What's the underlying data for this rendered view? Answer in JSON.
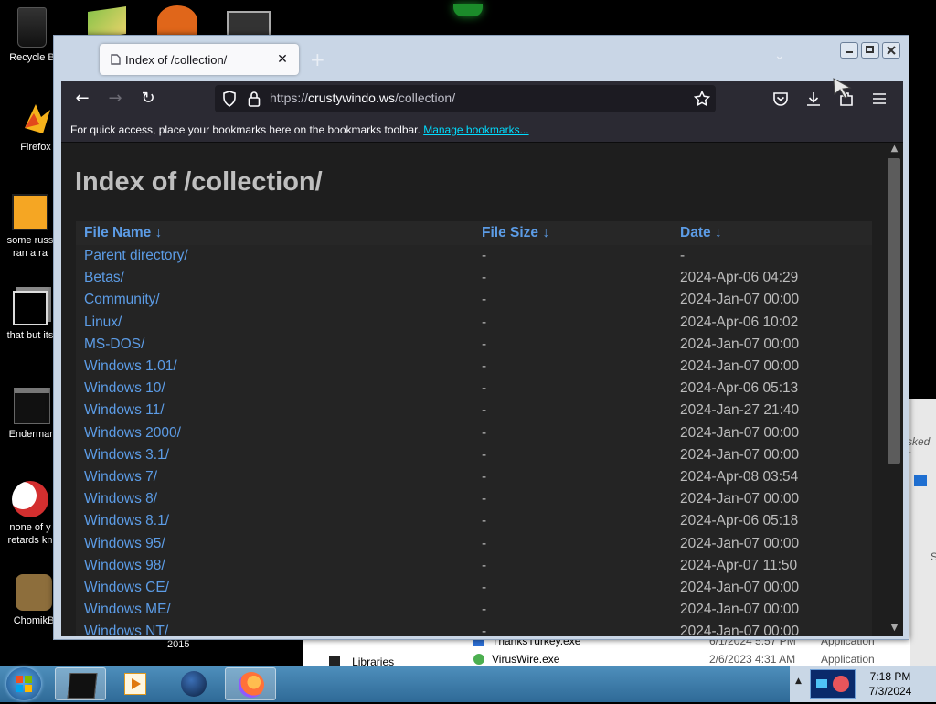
{
  "desktop": {
    "icons": [
      {
        "label": "Recycle B",
        "icon": "recycle-bin-icon"
      },
      {
        "label": "Firefox",
        "icon": "firefox-icon"
      },
      {
        "label": "some russ ran a ra",
        "icon": "program-icon"
      },
      {
        "label": "that but its",
        "icon": "shortcut-icon"
      },
      {
        "label": "Enderman",
        "icon": "terminal-icon"
      },
      {
        "label": "none of y retards kn",
        "icon": "app-icon"
      },
      {
        "label": "ChomikB",
        "icon": "chomik-icon"
      }
    ],
    "stray_label": "2015"
  },
  "explorer_back": {
    "side_item": "Libraries",
    "files": [
      {
        "name": "ThanksTurkey.exe",
        "date": "6/1/2024 5:57 PM",
        "type": "Application"
      },
      {
        "name": "VirusWire.exe",
        "date": "2/6/2023 4:31 AM",
        "type": "Application"
      }
    ],
    "peek_text": "sked r",
    "peek_letter": "S"
  },
  "browser": {
    "tab": {
      "title": "Index of /collection/",
      "close": "✕"
    },
    "new_tab": "+",
    "list_tabs": "⌄",
    "nav": {
      "back": "←",
      "forward": "→",
      "reload": "↻"
    },
    "url": {
      "prefix": "https://",
      "domain": "crustywindo.ws",
      "path": "/collection/"
    },
    "toolbar_icons": [
      "pocket-icon",
      "download-icon",
      "extensions-icon",
      "menu-icon"
    ],
    "bookmarks_bar": {
      "message": "For quick access, place your bookmarks here on the bookmarks toolbar.",
      "link": "Manage bookmarks..."
    }
  },
  "page": {
    "title": "Index of /collection/",
    "columns": [
      "File Name  ↓",
      "File Size  ↓",
      "Date  ↓"
    ],
    "rows": [
      {
        "name": "Parent directory/",
        "size": "-",
        "date": "-"
      },
      {
        "name": "Betas/",
        "size": "-",
        "date": "2024-Apr-06 04:29"
      },
      {
        "name": "Community/",
        "size": "-",
        "date": "2024-Jan-07 00:00"
      },
      {
        "name": "Linux/",
        "size": "-",
        "date": "2024-Apr-06 10:02"
      },
      {
        "name": "MS-DOS/",
        "size": "-",
        "date": "2024-Jan-07 00:00"
      },
      {
        "name": "Windows 1.01/",
        "size": "-",
        "date": "2024-Jan-07 00:00"
      },
      {
        "name": "Windows 10/",
        "size": "-",
        "date": "2024-Apr-06 05:13"
      },
      {
        "name": "Windows 11/",
        "size": "-",
        "date": "2024-Jan-27 21:40"
      },
      {
        "name": "Windows 2000/",
        "size": "-",
        "date": "2024-Jan-07 00:00"
      },
      {
        "name": "Windows 3.1/",
        "size": "-",
        "date": "2024-Jan-07 00:00"
      },
      {
        "name": "Windows 7/",
        "size": "-",
        "date": "2024-Apr-08 03:54"
      },
      {
        "name": "Windows 8/",
        "size": "-",
        "date": "2024-Jan-07 00:00"
      },
      {
        "name": "Windows 8.1/",
        "size": "-",
        "date": "2024-Apr-06 05:18"
      },
      {
        "name": "Windows 95/",
        "size": "-",
        "date": "2024-Jan-07 00:00"
      },
      {
        "name": "Windows 98/",
        "size": "-",
        "date": "2024-Apr-07 11:50"
      },
      {
        "name": "Windows CE/",
        "size": "-",
        "date": "2024-Jan-07 00:00"
      },
      {
        "name": "Windows ME/",
        "size": "-",
        "date": "2024-Jan-07 00:00"
      },
      {
        "name": "Windows NT/",
        "size": "-",
        "date": "2024-Jan-07 00:00"
      }
    ]
  },
  "taskbar": {
    "clock": {
      "time": "7:18 PM",
      "date": "7/3/2024"
    },
    "tray_arrow": "▲"
  },
  "colors": {
    "link": "#5c9ce6",
    "accent": "#00ddff",
    "page_bg": "#1e1e1e"
  }
}
